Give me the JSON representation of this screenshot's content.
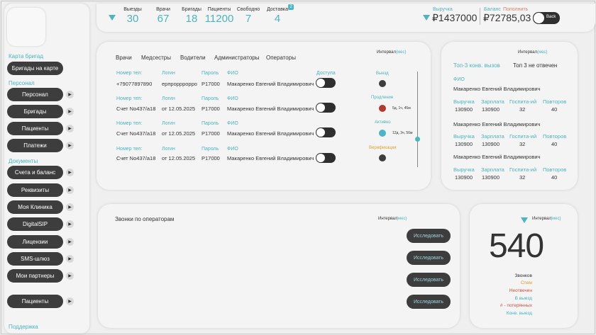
{
  "sidebar": {
    "section_map": "Карта бригад",
    "brigades_map_button": "Бригады на карте",
    "section_staff": "Персонал",
    "staff_items": [
      "Персонал",
      "Бригады",
      "Пациенты",
      "Платежи"
    ],
    "section_docs": "Документы",
    "doc_items": [
      "Счета и баланс",
      "Реквизиты",
      "Моя Клиника",
      "DigitalSIP",
      "Лицензии",
      "SMS-шлюз",
      "Мои партнеры"
    ],
    "patients_button": "Пациенты",
    "support": "Поддержка",
    "play_icon": "▶"
  },
  "topbar": {
    "stats": [
      {
        "label": "Выезды",
        "value": "30"
      },
      {
        "label": "Врачи",
        "value": "67"
      },
      {
        "label": "Бригады",
        "value": "18"
      },
      {
        "label": "Пациенты",
        "value": "11200"
      },
      {
        "label": "Свободно",
        "value": "7"
      },
      {
        "label": "Доставка",
        "value": "4"
      }
    ],
    "delivery_badge": "2",
    "revenue_label": "Выручка",
    "revenue_value": "₽1437000",
    "balance_label": "Баланс",
    "topup_label": "Пополнить",
    "balance_value": "₽72785,03",
    "toggle_label": "Back",
    "accent": "#4ab5c4",
    "topup_color": "#e08060"
  },
  "staff_panel": {
    "tabs": [
      "Врачи",
      "Медсестры",
      "Водители",
      "Администраторы",
      "Операторы"
    ],
    "active_tab": "Операторы",
    "interval_label": "Интервал",
    "interval_unit": "(мес)",
    "headers": {
      "phone": "Номер тел:",
      "login": "Логин",
      "password": "Пароль",
      "fio": "ФИО",
      "access": "Доступа"
    },
    "rows": [
      {
        "phone": "+79077897890",
        "login": "ерпрорррорро",
        "password": "Р17000",
        "fio": "Макаренко Евгений Владимирович"
      },
      {
        "phone": "Счет No437/а18",
        "login": "от 12.05.2025",
        "password": "Р17000",
        "fio": "Макаренко Евгений Владимирович"
      },
      {
        "phone": "Счет No437/а18",
        "login": "от 12.05.2025",
        "password": "Р17000",
        "fio": "Макаренко Евгений Владимирович"
      },
      {
        "phone": "Счет No437/а18",
        "login": "от 12.05.2025",
        "password": "Р17000",
        "fio": "Макаренко Евгений Владимирович"
      }
    ],
    "statuses": [
      {
        "label": "Выезд",
        "note": "",
        "color": "#3d3d3d",
        "label_color": "#4ab5c4"
      },
      {
        "label": "Продление",
        "note": "5д, 1ч, 45м",
        "color": "#b03a30",
        "label_color": "#4ab5c4"
      },
      {
        "label": "Активно",
        "note": "12д, 3ч, 56м",
        "color": "#4ab5c4",
        "label_color": "#4ab5c4"
      },
      {
        "label": "Верификация",
        "note": "",
        "color": "#3d3d3d",
        "label_color": "#e0a030"
      }
    ]
  },
  "top3_panel": {
    "interval_label": "Интервал",
    "interval_unit": "(мес)",
    "tab_calls": "Топ-3 конв. вызов",
    "tab_missed": "Топ 3 не отвечен",
    "fio_label": "ФИО",
    "entries": [
      {
        "fio": "Макаренко Евгений Владимирович",
        "revenue": "130900",
        "salary": "130900",
        "hosp": "32",
        "repeats": "40"
      },
      {
        "fio": "Макаренко Евгений Владимирович",
        "revenue": "130900",
        "salary": "130900",
        "hosp": "32",
        "repeats": "40"
      },
      {
        "fio": "Макаренко Евгений Владимирович",
        "revenue": "130900",
        "salary": "130900",
        "hosp": "32",
        "repeats": "40"
      }
    ],
    "col_labels": [
      "Выручка",
      "Зарплата",
      "Госпита-ий",
      "Повторов"
    ]
  },
  "calls_panel": {
    "title": "Звонки по операторам",
    "interval_label": "Интервал",
    "interval_unit": "(мес)",
    "buttons": [
      "Исследовать",
      "Исследовать",
      "Исследовать",
      "Исследовать"
    ]
  },
  "counter_panel": {
    "interval_label": "Интервал",
    "interval_unit": "(мес)",
    "value": "540",
    "legend": [
      {
        "text": "Звонков",
        "color": "#333333"
      },
      {
        "text": "Спам",
        "color": "#e0a030"
      },
      {
        "text": "Неотвечен",
        "color": "#d05040"
      },
      {
        "text": "В выезд",
        "color": "#4ab5c4"
      },
      {
        "text": "# - потерянных",
        "color": "#d05040"
      },
      {
        "text": "Конв. выезд",
        "color": "#4ab5c4"
      }
    ]
  }
}
